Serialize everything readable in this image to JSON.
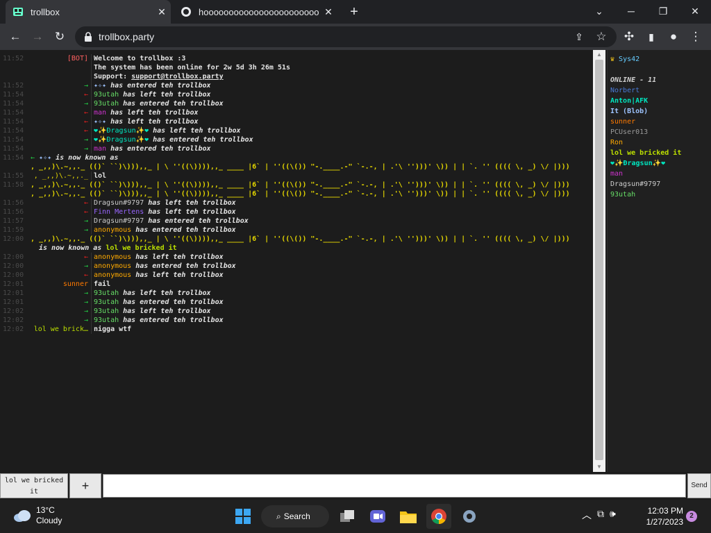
{
  "browser": {
    "tabs": [
      {
        "title": "trollbox",
        "close": "✕"
      },
      {
        "title": "hoooooooooooooooooooooooooo",
        "close": "✕"
      }
    ],
    "new_tab": "+",
    "url": "trollbox.party",
    "window_controls": {
      "list": "⌄",
      "minimize": "─",
      "maximize": "❐",
      "close": "✕"
    }
  },
  "colors": {
    "bot": "#ff6060",
    "join": "#22cc44",
    "leave": "#e02020",
    "time": "#4a4a4a",
    "ascii": "#e6d800",
    "sunner": "#ff7a00",
    "lolwe": "#bde000",
    "man": "#cc33cc",
    "finn": "#9966ff",
    "norbert": "#4a7bd8",
    "anton": "#00e6c0",
    "blob": "#9ec4ff",
    "pcuser": "#999999",
    "ron": "#ffaa00",
    "dragsun": "#cccccc",
    "utah": "#66dd66",
    "sys42": "#66ccff",
    "online": "#d0d0d0"
  },
  "chat": {
    "messages": [
      {
        "time": "11:52",
        "nick": "[BOT]",
        "nick_color": "bot",
        "text": "Welcome to trollbox :3"
      },
      {
        "time": "",
        "nick": "",
        "text": "The system has been online for 2w 5d 3h 26m 51s"
      },
      {
        "time": "",
        "nick": "",
        "text": "Support: ",
        "link": "support@trollbox.party"
      },
      {
        "time": "11:52",
        "arrow": "join",
        "user": "✦✧✦",
        "user_color": "blob",
        "action": "has entered teh trollbox"
      },
      {
        "time": "11:54",
        "arrow": "leave",
        "user": "93utah",
        "user_color": "utah",
        "action": "has left teh trollbox"
      },
      {
        "time": "11:54",
        "arrow": "join",
        "user": "93utah",
        "user_color": "utah",
        "action": "has entered teh trollbox"
      },
      {
        "time": "11:54",
        "arrow": "leave",
        "user": "man",
        "user_color": "man",
        "action": "has left teh trollbox"
      },
      {
        "time": "11:54",
        "arrow": "leave",
        "user": "✦✧✦",
        "user_color": "blob",
        "action": "has left teh trollbox"
      },
      {
        "time": "11:54",
        "arrow": "leave",
        "user": "❤✨Ðragsun✨❤",
        "user_color": "anton",
        "action": "has left teh trollbox"
      },
      {
        "time": "11:54",
        "arrow": "join",
        "user": "❤✨Ðragsun✨❤",
        "user_color": "anton",
        "action": "has entered teh trollbox"
      },
      {
        "time": "11:54",
        "arrow": "join",
        "user": "man",
        "user_color": "man",
        "action": "has entered teh trollbox"
      },
      {
        "time": "11:54",
        "wide": true,
        "arrow": "join",
        "user": "✦✧✦",
        "user_color": "blob",
        "action": "is now known as"
      },
      {
        "time": "",
        "ascii": ", _,,)\\.~,,._ (()` ``)\\))),,_ | \\ ''((\\)))),,_ ____ |6` | ''((\\()) \"-.____.-\" `-.-, | .'\\ '')))' \\)) | | `. '' (((( \\, _) \\/ |)))"
      },
      {
        "time": "11:55",
        "nick": ", _,,)\\.~,,._",
        "nick_color": "ascii",
        "text": "lol"
      },
      {
        "time": "11:58",
        "ascii": ", _,,)\\.~,,._ (()` ``)\\))),,_ | \\ ''((\\)))),,_ ____ |6` | ''((\\()) \"-.____.-\" `-.-, | .'\\ '')))' \\)) | | `. '' (((( \\, _) \\/ |)))"
      },
      {
        "time": "",
        "ascii": ", _,,)\\.~,,._ (()` ``)\\))),,_ | \\ ''((\\)))),,_ ____ |6` | ''((\\()) \"-.____.-\" `-.-, | .'\\ '')))' \\)) | | `. '' (((( \\, _) \\/ |)))"
      },
      {
        "time": "11:56",
        "arrow": "leave",
        "user": "Dragsun#9797",
        "user_color": "dragsun",
        "action": "has left teh trollbox"
      },
      {
        "time": "11:56",
        "arrow": "leave",
        "user": "Finn Mertens",
        "user_color": "finn",
        "action": "has left teh trollbox"
      },
      {
        "time": "11:57",
        "arrow": "join",
        "user": "Dragsun#9797",
        "user_color": "dragsun",
        "action": "has entered teh trollbox"
      },
      {
        "time": "11:59",
        "arrow": "join",
        "user": "anonymous",
        "user_color": "ron",
        "action": "has entered teh trollbox"
      },
      {
        "time": "12:00",
        "ascii": ", _,,)\\.~,,._ (()` ``)\\))),,_ | \\ ''((\\)))),,_ ____ |6` | ''((\\()) \"-.____.-\" `-.-, | .'\\ '')))' \\)) | | `. '' (((( \\, _) \\/ |)))"
      },
      {
        "time": "",
        "known": true,
        "action": "is now known as",
        "user": "lol we bricked it",
        "user_color": "lolwe"
      },
      {
        "time": "12:00",
        "arrow": "leave",
        "user": "anonymous",
        "user_color": "ron",
        "action": "has left teh trollbox"
      },
      {
        "time": "12:00",
        "arrow": "join",
        "user": "anonymous",
        "user_color": "ron",
        "action": "has entered teh trollbox"
      },
      {
        "time": "12:00",
        "arrow": "leave",
        "user": "anonymous",
        "user_color": "ron",
        "action": "has left teh trollbox"
      },
      {
        "time": "12:01",
        "nick": "sunner",
        "nick_color": "sunner",
        "text": "fail"
      },
      {
        "time": "12:01",
        "arrow": "join",
        "user": "93utah",
        "user_color": "utah",
        "action": "has left teh trollbox"
      },
      {
        "time": "12:01",
        "arrow": "join",
        "user": "93utah",
        "user_color": "utah",
        "action": "has entered teh trollbox"
      },
      {
        "time": "12:02",
        "arrow": "join",
        "user": "93utah",
        "user_color": "utah",
        "action": "has left teh trollbox"
      },
      {
        "time": "12:02",
        "arrow": "join",
        "user": "93utah",
        "user_color": "utah",
        "action": "has entered teh trollbox"
      },
      {
        "time": "12:02",
        "nick": "lol we brick…",
        "nick_color": "lolwe",
        "text": "nigga wtf"
      }
    ]
  },
  "users": {
    "owner": "Sys42",
    "online_label": "ONLINE - 11",
    "list": [
      {
        "name": "Norbert",
        "color": "norbert"
      },
      {
        "name": "Anton|AFK",
        "color": "anton"
      },
      {
        "name": "It (Blob)",
        "color": "blob"
      },
      {
        "name": "sunner",
        "color": "sunner"
      },
      {
        "name": "PCUser013",
        "color": "pcuser"
      },
      {
        "name": "Ron",
        "color": "ron"
      },
      {
        "name": "lol we bricked it",
        "color": "lolwe"
      },
      {
        "name": "❤✨Ðragsun✨❤",
        "color": "anton"
      },
      {
        "name": "man",
        "color": "man"
      },
      {
        "name": "Dragsun#9797",
        "color": "dragsun"
      },
      {
        "name": "93utah",
        "color": "utah"
      }
    ]
  },
  "composer": {
    "channel": "lol we bricked it",
    "add": "+",
    "input_value": "",
    "send": "Send"
  },
  "taskbar": {
    "temp": "13°C",
    "condition": "Cloudy",
    "search": "Search",
    "time": "12:03 PM",
    "date": "1/27/2023",
    "notifications": "2"
  }
}
